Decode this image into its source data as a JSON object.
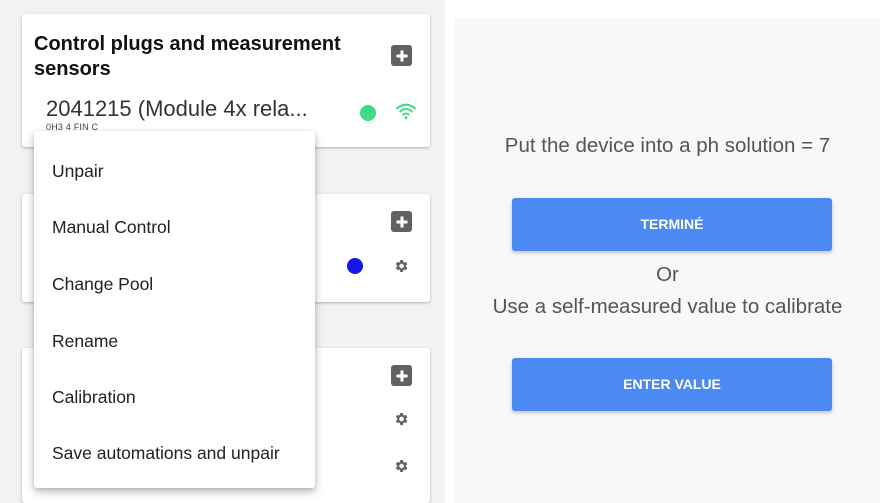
{
  "cards": {
    "first": {
      "title": "Control plugs and measurement sensors",
      "device_name": "2041215 (Module 4x rela...",
      "device_subtitle": "0H3 4 FIN C",
      "status_color": "#3ddc84",
      "wifi_color": "#3ddc84"
    },
    "second": {
      "status_color": "#1418e6"
    }
  },
  "menu": {
    "items": [
      {
        "label": "Unpair"
      },
      {
        "label": "Manual Control"
      },
      {
        "label": "Change Pool"
      },
      {
        "label": "Rename"
      },
      {
        "label": "Calibration"
      },
      {
        "label": "Save automations and unpair"
      }
    ]
  },
  "calibration": {
    "instruction": "Put the device into a ph solution = 7",
    "done_button": "TERMINÉ",
    "or_text": "Or",
    "alt_text": "Use a self-measured value to calibrate",
    "enter_button": "ENTER VALUE",
    "accent_color": "#4a8af2"
  },
  "icons": {
    "add": "plus-square-icon",
    "wifi": "wifi-icon",
    "settings": "gear-icon"
  }
}
